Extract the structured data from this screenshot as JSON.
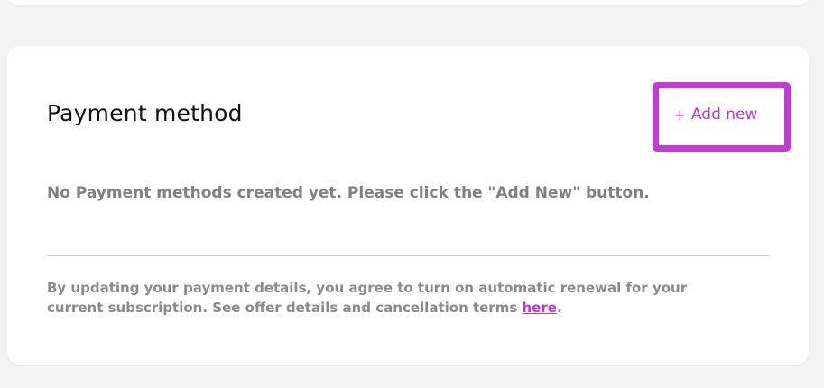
{
  "payment": {
    "title": "Payment method",
    "add_new_label": "Add new",
    "add_new_icon": "plus-icon",
    "empty_message": "No Payment methods created yet. Please click the \"Add New\" button.",
    "disclaimer_text": "By updating your payment details, you agree to turn on automatic renewal for your current subscription. See offer details and cancellation terms ",
    "disclaimer_link": "here",
    "disclaimer_end": "."
  },
  "colors": {
    "accent": "#b53ad0",
    "highlight_border": "#c33ad8",
    "background": "#f3f3f3",
    "card": "#ffffff"
  }
}
